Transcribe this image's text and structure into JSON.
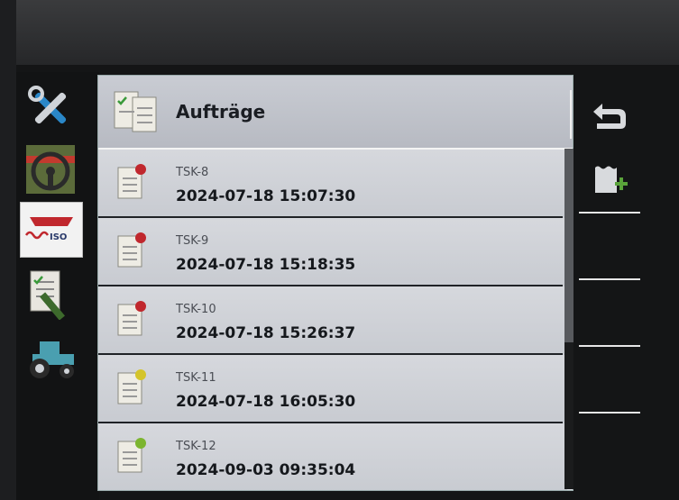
{
  "header": {
    "title": "Aufträge"
  },
  "tasks": [
    {
      "id": "TSK-8",
      "timestamp": "2024-07-18 15:07:30",
      "status_color": "#c0272d"
    },
    {
      "id": "TSK-9",
      "timestamp": "2024-07-18 15:18:35",
      "status_color": "#c0272d"
    },
    {
      "id": "TSK-10",
      "timestamp": "2024-07-18 15:26:37",
      "status_color": "#c0272d"
    },
    {
      "id": "TSK-11",
      "timestamp": "2024-07-18 16:05:30",
      "status_color": "#d4c42a"
    },
    {
      "id": "TSK-12",
      "timestamp": "2024-09-03 09:35:04",
      "status_color": "#7cb52f"
    }
  ],
  "rail": {
    "items": [
      {
        "icon": "tools-icon"
      },
      {
        "icon": "steering-wheel-icon"
      },
      {
        "icon": "isobus-icon",
        "label": "ISO",
        "active": true
      },
      {
        "icon": "task-edit-icon"
      },
      {
        "icon": "tractor-icon"
      }
    ]
  },
  "softkeys": {
    "back": "back-arrow-icon",
    "new_task": "new-task-icon"
  },
  "colors": {
    "accent_red": "#c0272d",
    "accent_green": "#7cb52f",
    "tractor": "#4a9fb0"
  }
}
